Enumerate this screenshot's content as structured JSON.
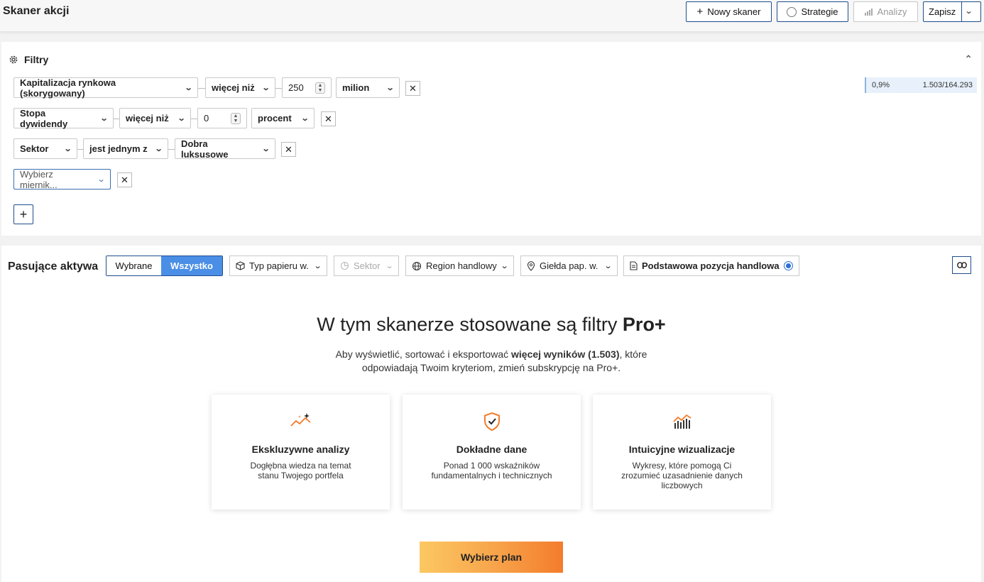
{
  "header": {
    "title": "Skaner akcji",
    "new_scanner": "Nowy skaner",
    "strategies": "Strategie",
    "analyses": "Analizy",
    "save": "Zapisz"
  },
  "filters": {
    "title": "Filtry",
    "rows": [
      {
        "metric": "Kapitalizacja rynkowa (skorygowany)",
        "operator": "więcej niż",
        "value": "250",
        "unit": "milion"
      },
      {
        "metric": "Stopa dywidendy",
        "operator": "więcej niż",
        "value": "0",
        "unit": "procent"
      },
      {
        "metric": "Sektor",
        "operator": "jest jednym z",
        "value": "Dobra luksusowe"
      }
    ],
    "metric_placeholder": "Wybierz miernik...",
    "stat_percent": "0,9%",
    "stat_count": "1.503/164.293"
  },
  "results": {
    "title": "Pasujące aktywa",
    "seg_selected": "Wybrane",
    "seg_all": "Wszystko",
    "filter_security_type": "Typ papieru w.",
    "filter_sector": "Sektor",
    "filter_region": "Region handlowy",
    "filter_exchange": "Giełda pap. w.",
    "filter_primary_listing": "Podstawowa pozycja handlowa"
  },
  "promo": {
    "heading_prefix": "W tym skanerze stosowane są filtry ",
    "heading_bold": "Pro+",
    "text_prefix": "Aby wyświetlić, sortować i eksportować ",
    "text_bold": "więcej wyników (1.503)",
    "text_suffix": ", które odpowiadają Twoim kryteriom, zmień subskrypcję na Pro+.",
    "cards": [
      {
        "icon": "sparkle-trend-icon",
        "title": "Ekskluzywne analizy",
        "desc": "Dogłębna wiedza na temat stanu Twojego portfela"
      },
      {
        "icon": "shield-check-icon",
        "title": "Dokładne dane",
        "desc": "Ponad 1 000 wskaźników fundamentalnych i technicznych"
      },
      {
        "icon": "bar-chart-icon",
        "title": "Intuicyjne wizualizacje",
        "desc": "Wykresy, które pomogą Ci zrozumieć uzasadnienie danych liczbowych"
      }
    ],
    "cta": "Wybierz plan"
  },
  "colors": {
    "accent": "#1f4e8c",
    "active_seg": "#4a8ee6",
    "orange": "#f47c2b"
  }
}
